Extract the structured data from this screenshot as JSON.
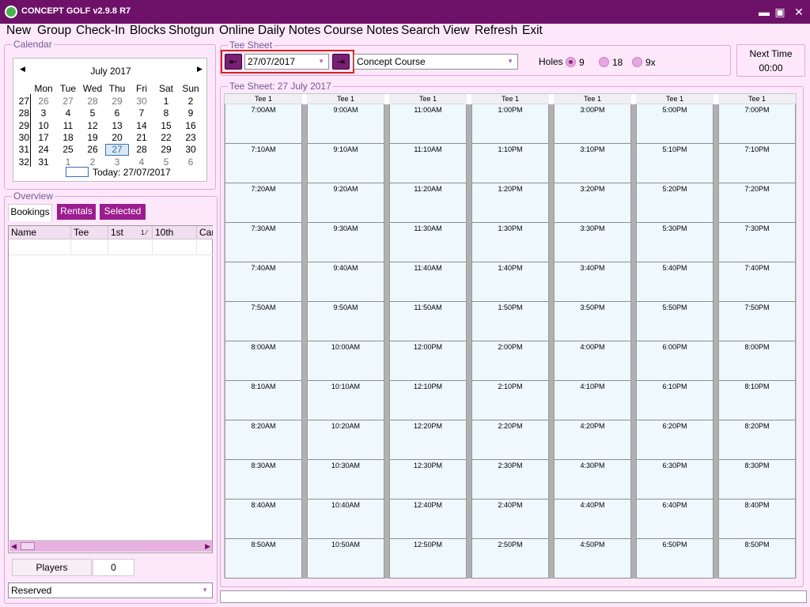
{
  "window": {
    "title": "CONCEPT GOLF v2.9.8 R7",
    "min": "▬",
    "max": "▣",
    "close": "✕"
  },
  "menu": [
    "New",
    "Group",
    "Check-In",
    "Blocks",
    "Shotgun",
    "Online",
    "Daily Notes",
    "Course Notes",
    "Search",
    "View",
    "Refresh",
    "Exit"
  ],
  "calendar": {
    "group": "Calendar",
    "month": "July 2017",
    "prev": "◀",
    "next": "▶",
    "dow": [
      "Mon",
      "Tue",
      "Wed",
      "Thu",
      "Fri",
      "Sat",
      "Sun"
    ],
    "weeks": [
      {
        "wk": "27",
        "days": [
          "26",
          "27",
          "28",
          "29",
          "30",
          "1",
          "2"
        ],
        "other": [
          0,
          1,
          2,
          3,
          4
        ]
      },
      {
        "wk": "28",
        "days": [
          "3",
          "4",
          "5",
          "6",
          "7",
          "8",
          "9"
        ],
        "other": []
      },
      {
        "wk": "29",
        "days": [
          "10",
          "11",
          "12",
          "13",
          "14",
          "15",
          "16"
        ],
        "other": []
      },
      {
        "wk": "30",
        "days": [
          "17",
          "18",
          "19",
          "20",
          "21",
          "22",
          "23"
        ],
        "other": []
      },
      {
        "wk": "31",
        "days": [
          "24",
          "25",
          "26",
          "27",
          "28",
          "29",
          "30"
        ],
        "other": [],
        "sel": 3
      },
      {
        "wk": "32",
        "days": [
          "31",
          "1",
          "2",
          "3",
          "4",
          "5",
          "6"
        ],
        "other": [
          1,
          2,
          3,
          4,
          5,
          6
        ]
      }
    ],
    "today": "Today: 27/07/2017"
  },
  "overview": {
    "group": "Overview",
    "tabs": [
      "Bookings",
      "Rentals",
      "Selected"
    ],
    "columns": [
      "Name",
      "Tee",
      "1st",
      "10th",
      "Car"
    ],
    "sort_indicator": "1 ⁄",
    "players_label": "Players",
    "players_count": "0",
    "status_select": "Reserved"
  },
  "teesheet": {
    "group": "Tee Sheet",
    "date": "27/07/2017",
    "course": "Concept Course",
    "holes_label": "Holes",
    "holes": [
      "9",
      "18",
      "9x"
    ],
    "holes_selected": "9",
    "prev": "⇤",
    "next": "⇥",
    "next_time_label": "Next Time",
    "next_time": "00:00",
    "sheet_title": "Tee Sheet: 27 July 2017",
    "columns": [
      {
        "tee": "Tee 1",
        "times": [
          "7:00AM",
          "7:10AM",
          "7:20AM",
          "7:30AM",
          "7:40AM",
          "7:50AM",
          "8:00AM",
          "8:10AM",
          "8:20AM",
          "8:30AM",
          "8:40AM",
          "8:50AM"
        ]
      },
      {
        "tee": "Tee 1",
        "times": [
          "9:00AM",
          "9:10AM",
          "9:20AM",
          "9:30AM",
          "9:40AM",
          "9:50AM",
          "10:00AM",
          "10:10AM",
          "10:20AM",
          "10:30AM",
          "10:40AM",
          "10:50AM"
        ]
      },
      {
        "tee": "Tee 1",
        "times": [
          "11:00AM",
          "11:10AM",
          "11:20AM",
          "11:30AM",
          "11:40AM",
          "11:50AM",
          "12:00PM",
          "12:10PM",
          "12:20PM",
          "12:30PM",
          "12:40PM",
          "12:50PM"
        ]
      },
      {
        "tee": "Tee 1",
        "times": [
          "1:00PM",
          "1:10PM",
          "1:20PM",
          "1:30PM",
          "1:40PM",
          "1:50PM",
          "2:00PM",
          "2:10PM",
          "2:20PM",
          "2:30PM",
          "2:40PM",
          "2:50PM"
        ]
      },
      {
        "tee": "Tee 1",
        "times": [
          "3:00PM",
          "3:10PM",
          "3:20PM",
          "3:30PM",
          "3:40PM",
          "3:50PM",
          "4:00PM",
          "4:10PM",
          "4:20PM",
          "4:30PM",
          "4:40PM",
          "4:50PM"
        ]
      },
      {
        "tee": "Tee 1",
        "times": [
          "5:00PM",
          "5:10PM",
          "5:20PM",
          "5:30PM",
          "5:40PM",
          "5:50PM",
          "6:00PM",
          "6:10PM",
          "6:20PM",
          "6:30PM",
          "6:40PM",
          "6:50PM"
        ]
      },
      {
        "tee": "Tee 1",
        "times": [
          "7:00PM",
          "7:10PM",
          "7:20PM",
          "7:30PM",
          "7:40PM",
          "7:50PM",
          "8:00PM",
          "8:10PM",
          "8:20PM",
          "8:30PM",
          "8:40PM",
          "8:50PM"
        ]
      }
    ]
  },
  "colors": {
    "titlebar": "#6e1269",
    "accent": "#9b1d8f",
    "highlight_box": "#d9201f",
    "background": "#fde8fb",
    "slot": "#eef8fd"
  },
  "icons": {
    "app": "golf-logo-icon",
    "prev_date": "prev-date-icon",
    "next_date": "next-date-icon"
  }
}
